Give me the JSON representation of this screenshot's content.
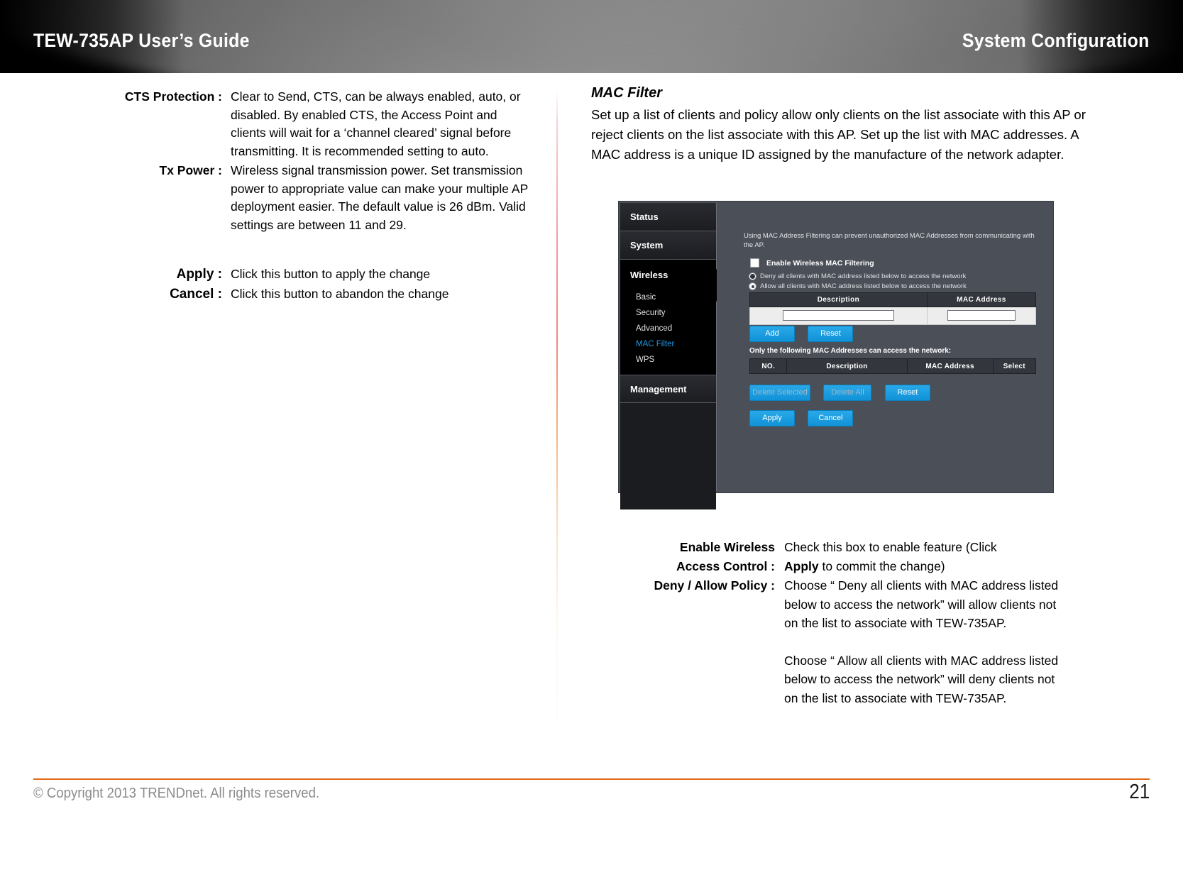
{
  "header": {
    "title": "TEW-735AP User’s Guide",
    "section": "System Configuration"
  },
  "left_column": {
    "definitions": [
      {
        "term": "CTS Protection :",
        "desc": "Clear to Send, CTS, can be always enabled, auto, or disabled. By enabled CTS, the Access Point and clients will wait for a ‘channel cleared’ signal before transmitting. It is recommended setting to auto."
      },
      {
        "term": "Tx Power :",
        "desc": "Wireless signal transmission power. Set transmission power to appropriate value can make your multiple AP deployment easier.  The default value is 26 dBm. Valid settings are between 11 and 29."
      }
    ],
    "actions": [
      {
        "term": "Apply :",
        "desc": "Click this button to apply the change"
      },
      {
        "term": "Cancel :",
        "desc": "Click this button to abandon the change"
      }
    ]
  },
  "right_column": {
    "section_title": "MAC Filter",
    "section_paragraph": "Set up a list of clients and policy allow only clients on the list associate with this AP or reject clients on the list associate with this AP. Set up the list with MAC addresses. A MAC address is a unique ID assigned by the manufacture of the network adapter."
  },
  "router_ui": {
    "nav": {
      "items": [
        {
          "label": "Status",
          "type": "main",
          "active": false
        },
        {
          "label": "System",
          "type": "main",
          "active": false
        },
        {
          "label": "Wireless",
          "type": "main",
          "active": true
        },
        {
          "label": "Management",
          "type": "main",
          "active": false
        }
      ],
      "wireless_sub": [
        {
          "label": "Basic",
          "selected": false
        },
        {
          "label": "Security",
          "selected": false
        },
        {
          "label": "Advanced",
          "selected": false
        },
        {
          "label": "MAC Filter",
          "selected": true
        },
        {
          "label": "WPS",
          "selected": false
        }
      ],
      "selected_color": "#1e9ae6"
    },
    "help_text": "Using MAC Address Filtering can prevent unauthorized MAC Addresses from communicating with the AP.",
    "enable_checkbox_label": "Enable Wireless MAC Filtering",
    "enable_checkbox_checked": false,
    "policy_options": [
      {
        "label": "Deny all clients with MAC address listed below to access the network",
        "selected": true
      },
      {
        "label": "Allow all clients with MAC address listed below to access the network",
        "selected": false
      }
    ],
    "entry_table": {
      "headers": [
        "Description",
        "MAC Address"
      ],
      "row_values": [
        "",
        ""
      ]
    },
    "entry_buttons": [
      {
        "label": "Add",
        "dim": false
      },
      {
        "label": "Reset",
        "dim": false
      }
    ],
    "list_label": "Only the following MAC Addresses can access the network:",
    "list_table": {
      "headers": [
        "NO.",
        "Description",
        "MAC Address",
        "Select"
      ],
      "rows": []
    },
    "list_buttons": [
      {
        "label": "Delete Selected",
        "dim": true
      },
      {
        "label": "Delete All",
        "dim": true
      },
      {
        "label": "Reset",
        "dim": false
      }
    ],
    "commit_buttons": [
      {
        "label": "Apply",
        "dim": false
      },
      {
        "label": "Cancel",
        "dim": false
      }
    ],
    "button_color": "#1192d8"
  },
  "bottom_right": {
    "rows": [
      {
        "term_line1": "Enable Wireless",
        "term_line2": "Access Control :",
        "desc_line1": "Check this box to enable feature (Click",
        "desc_line2_bold": "Apply",
        "desc_line2_rest": " to commit the change)"
      },
      {
        "term_line1": "Deny / Allow Policy :",
        "para1": "Choose “ Deny all clients with MAC address listed below to access the network” will allow clients not on the list to associate with TEW-735AP.",
        "para2": "Choose “ Allow all clients with MAC address listed below to access the network” will deny clients not on the list to associate with TEW-735AP."
      }
    ]
  },
  "footer": {
    "copyright": "© Copyright 2013 TRENDnet. All rights reserved.",
    "page_number": "21",
    "rule_color": "#e2691a"
  }
}
